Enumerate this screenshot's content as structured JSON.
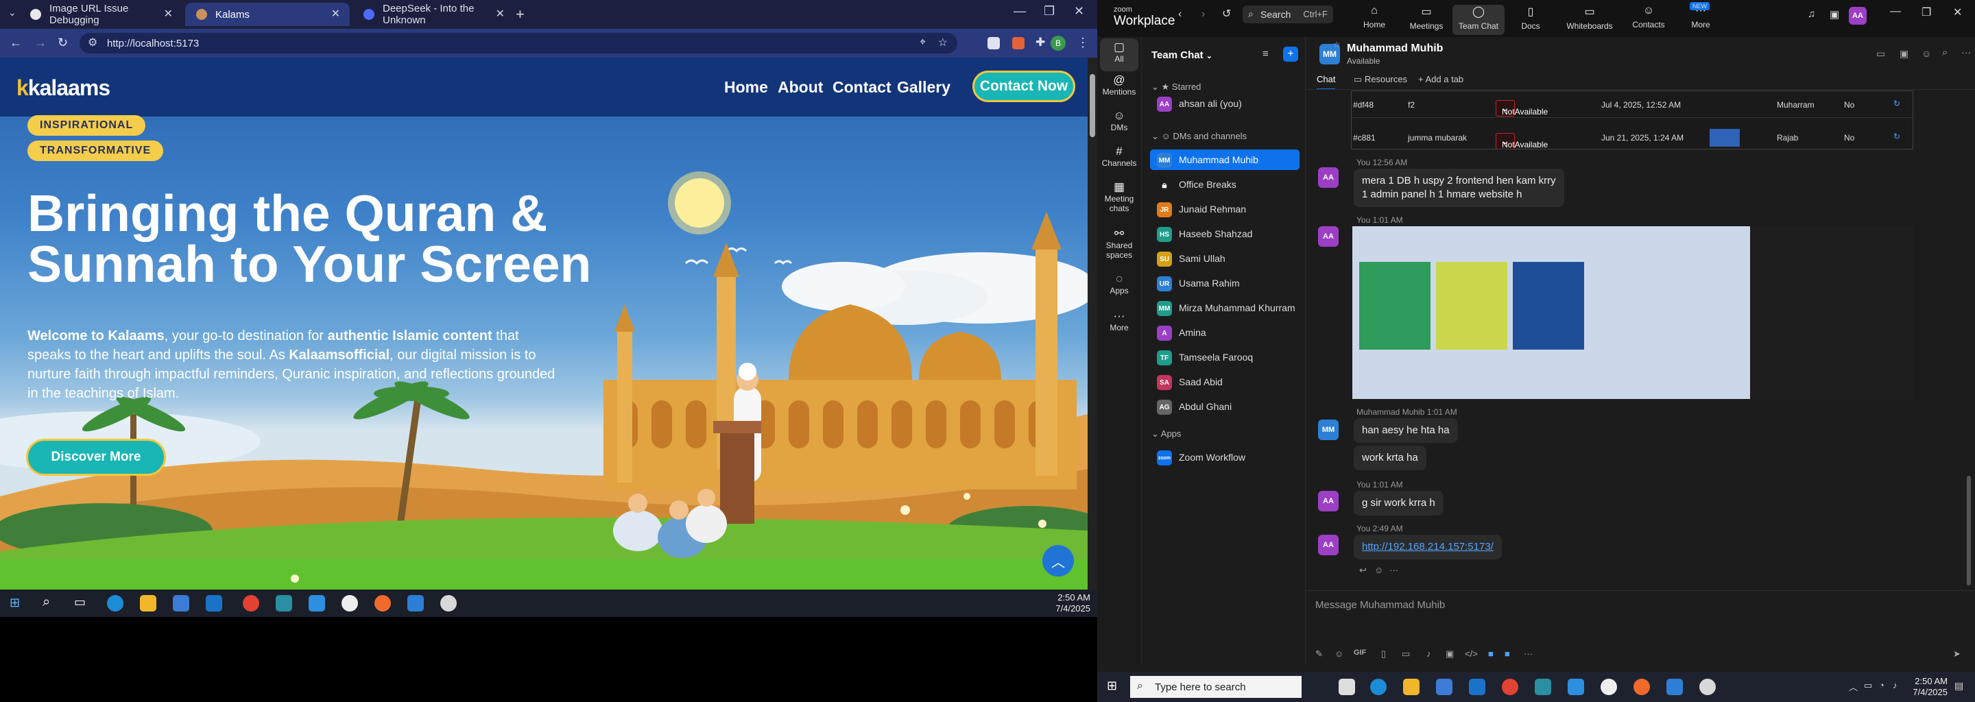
{
  "browser": {
    "tabs": [
      {
        "title": "Image URL Issue Debugging",
        "active": false
      },
      {
        "title": "Kalams",
        "active": true
      },
      {
        "title": "DeepSeek - Into the Unknown",
        "active": false
      }
    ],
    "url": "http://localhost:5173",
    "profile_initial": "B"
  },
  "site": {
    "logo_prefix": "k",
    "logo_text": "kalaams",
    "nav": [
      "Home",
      "About",
      "Contact",
      "Gallery"
    ],
    "contact_button": "Contact Now",
    "badges": [
      "INSPIRATIONAL",
      "TRANSFORMATIVE"
    ],
    "hero_title": "Bringing the Quran & Sunnah to Your Screen",
    "hero_desc": {
      "p1": "Welcome to Kalaams",
      "p2": ", your go-to destination for ",
      "p3": "authentic Islamic content",
      "p4": " that speaks to the heart and uplifts the soul. As ",
      "p5": "Kalaamsofficial",
      "p6": ", our digital mission is to nurture faith through impactful reminders, Quranic inspiration, and reflections grounded in the teachings of Islam."
    },
    "discover_button": "Discover More"
  },
  "left_taskbar": {
    "time": "2:50 AM",
    "date": "7/4/2025"
  },
  "zoom": {
    "brand_top": "zoom",
    "brand": "Workplace",
    "search": "Search",
    "search_shortcut": "Ctrl+F",
    "nav": [
      {
        "label": "Home",
        "active": false
      },
      {
        "label": "Meetings",
        "active": false
      },
      {
        "label": "Team Chat",
        "active": true
      },
      {
        "label": "Docs",
        "active": false
      },
      {
        "label": "Whiteboards",
        "active": false
      },
      {
        "label": "Contacts",
        "active": false
      },
      {
        "label": "More",
        "active": false
      }
    ],
    "more_badge": "NEW",
    "user_initials": "AA",
    "rail": [
      {
        "label": "All"
      },
      {
        "label": "Mentions"
      },
      {
        "label": "DMs"
      },
      {
        "label": "Channels"
      },
      {
        "label": "Meeting chats"
      },
      {
        "label": "Shared spaces"
      },
      {
        "label": "Apps"
      },
      {
        "label": "More"
      }
    ],
    "list_title": "Team Chat",
    "sections": {
      "starred": "Starred",
      "dms": "DMs and channels",
      "apps": "Apps"
    },
    "starred_contact": {
      "name": "ahsan ali (you)",
      "initials": "AA"
    },
    "contacts": [
      {
        "name": "Muhammad Muhib",
        "initials": "MM",
        "color": "#2d7fd6"
      },
      {
        "name": "Office Breaks",
        "initials": "",
        "color": "#444444"
      },
      {
        "name": "Junaid Rehman",
        "initials": "JR",
        "color": "#e07b1a"
      },
      {
        "name": "Haseeb Shahzad",
        "initials": "HS",
        "color": "#1f9c8a"
      },
      {
        "name": "Sami Ullah",
        "initials": "SU",
        "color": "#d4a017"
      },
      {
        "name": "Usama Rahim",
        "initials": "UR",
        "color": "#2d7fd6"
      },
      {
        "name": "Mirza Muhammad Khurram",
        "initials": "MM",
        "color": "#1f9c8a"
      },
      {
        "name": "Amina",
        "initials": "A",
        "color": "#9b3fc4"
      },
      {
        "name": "Tamseela Farooq",
        "initials": "TF",
        "color": "#1f9c8a"
      },
      {
        "name": "Saad Abid",
        "initials": "SA",
        "color": "#c4365d"
      },
      {
        "name": "Abdul Ghani",
        "initials": "AG",
        "color": "#666666"
      }
    ],
    "app_item": {
      "name": "Zoom Workflow",
      "initials": "zoom"
    },
    "chat": {
      "name": "Muhammad Muhib",
      "status": "Available",
      "initials": "MM",
      "tabs": [
        "Chat",
        "Resources",
        "Add a tab"
      ],
      "table_rows": [
        {
          "id": "#df48",
          "name": "f2",
          "status": "NotAvailable",
          "date": "Jul 4, 2025, 12:52 AM",
          "month": "Muharram",
          "flag": "No"
        },
        {
          "id": "#c881",
          "name": "jumma mubarak",
          "status": "NotAvailable",
          "date": "Jun 21, 2025, 1:24 AM",
          "month": "Rajab",
          "flag": "No"
        }
      ],
      "messages": [
        {
          "meta": "You 12:56 AM",
          "text1": "mera 1 DB h uspy 2 frontend hen kam krry",
          "text2": "1 admin panel h 1 hmare website h"
        },
        {
          "meta": "You 1:01 AM"
        },
        {
          "meta": "Muhammad Muhib 1:01 AM",
          "text1": "han aesy he hta ha",
          "text2": "work krta ha"
        },
        {
          "meta": "You 1:01 AM",
          "text1": "g sir work krra h"
        },
        {
          "meta": "You 2:49 AM",
          "link": "http://192.168.214.157:5173/"
        }
      ],
      "composer_placeholder": "Message Muhammad Muhib",
      "gif": "GIF"
    }
  },
  "right_taskbar": {
    "search_placeholder": "Type here to search",
    "time": "2:50 AM",
    "date": "7/4/2025"
  }
}
